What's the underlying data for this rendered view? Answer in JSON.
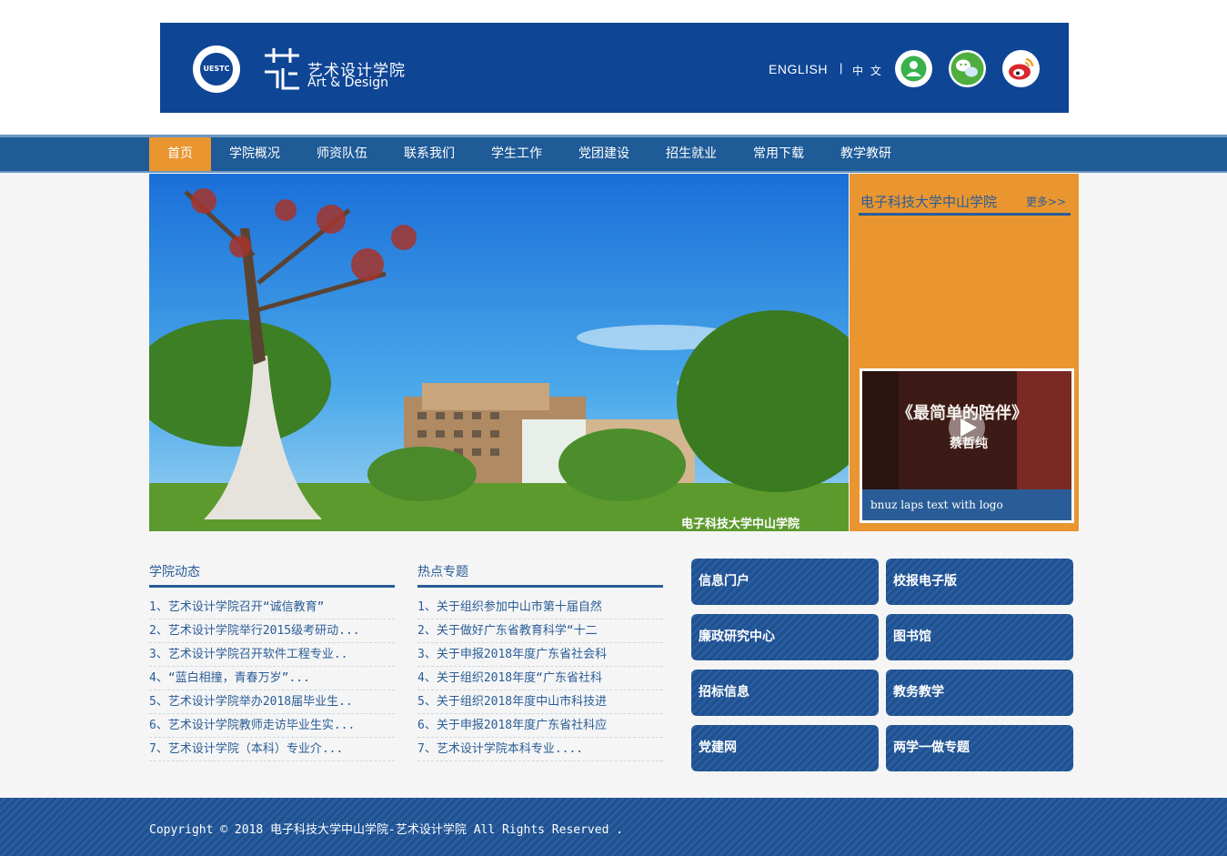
{
  "header": {
    "logo_cn": "艺术设计学院",
    "logo_en": "Art & Design",
    "lang_english": "ENGLISH",
    "lang_sep": "|",
    "lang_chinese": "中 文",
    "accent": "#0f4595"
  },
  "nav": {
    "items": [
      "首页",
      "学院概况",
      "师资队伍",
      "联系我们",
      "学生工作",
      "党团建设",
      "招生就业",
      "常用下载",
      "教学教研"
    ],
    "active_index": 0,
    "active_color": "#e99530"
  },
  "sidebar": {
    "title": "电子科技大学中山学院",
    "more": "更多>>",
    "video_title": "《最简单的陪伴》",
    "video_name": "蔡哲纯",
    "video_caption": "bnuz laps text with logo"
  },
  "news": {
    "title": "学院动态",
    "items": [
      "1、艺术设计学院召开“诚信教育”",
      "2、艺术设计学院举行2015级考研动...",
      "3、艺术设计学院召开软件工程专业..",
      "4、“蓝白相撞，青春万岁”...",
      "5、艺术设计学院举办2018届毕业生..",
      "6、艺术设计学院教师走访毕业生实...",
      "7、艺术设计学院（本科）专业介..."
    ]
  },
  "topics": {
    "title": "热点专题",
    "items": [
      "1、关于组织参加中山市第十届自然",
      "2、关于做好广东省教育科学“十二",
      "3、关于申报2018年度广东省社会科",
      "4、关于组织2018年度“广东省社科",
      "5、关于组织2018年度中山市科技进",
      "6、关于申报2018年度广东省社科应",
      "7、艺术设计学院本科专业...."
    ]
  },
  "quick_links": [
    "信息门户",
    "校报电子版",
    "廉政研究中心",
    "图书馆",
    "招标信息",
    "教务教学",
    "党建网",
    "两学一做专题"
  ],
  "banner": {
    "watermark": "电子科技大学中山学院"
  },
  "footer": {
    "copyright": "Copyright © 2018 电子科技大学中山学院-艺术设计学院 All Rights Reserved ."
  }
}
